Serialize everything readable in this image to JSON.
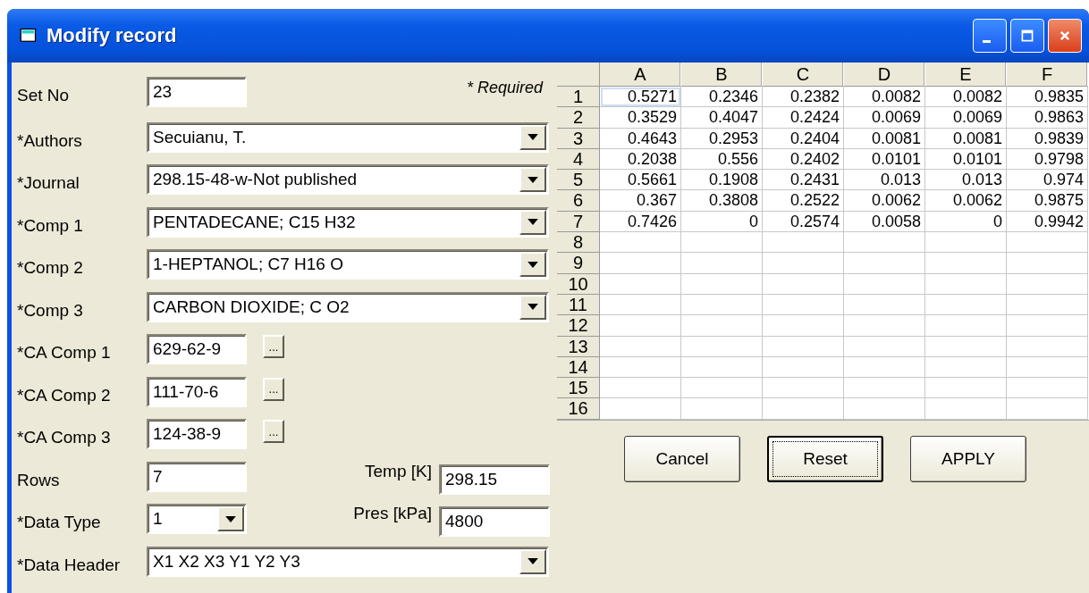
{
  "window": {
    "title": "Modify record"
  },
  "required_note": "* Required",
  "fields": [
    {
      "label": "Set No",
      "kind": "text",
      "value": "23"
    },
    {
      "label": "*Authors",
      "kind": "combo",
      "value": "Secuianu, T."
    },
    {
      "label": "*Journal",
      "kind": "combo",
      "value": "298.15-48-w-Not published"
    },
    {
      "label": "*Comp 1",
      "kind": "combo",
      "value": "PENTADECANE; C15 H32"
    },
    {
      "label": "*Comp 2",
      "kind": "combo",
      "value": "1-HEPTANOL; C7 H16 O"
    },
    {
      "label": "*Comp 3",
      "kind": "combo",
      "value": "CARBON DIOXIDE; C O2"
    },
    {
      "label": "*CA Comp 1",
      "kind": "lookup",
      "value": "629-62-9",
      "button": "..."
    },
    {
      "label": "*CA Comp 2",
      "kind": "lookup",
      "value": "111-70-6",
      "button": "..."
    },
    {
      "label": "*CA Comp 3",
      "kind": "lookup",
      "value": "124-38-9",
      "button": "..."
    },
    {
      "label": "Rows",
      "kind": "text",
      "value": "7",
      "extra": {
        "label": "Temp [K]",
        "value": "298.15"
      }
    },
    {
      "label": "*Data Type",
      "kind": "small_combo",
      "value": "1",
      "extra": {
        "label": "Pres [kPa]",
        "value": "4800"
      }
    },
    {
      "label": "*Data Header",
      "kind": "combo",
      "value": "X1 X2 X3 Y1 Y2 Y3"
    }
  ],
  "table": {
    "columns": [
      "A",
      "B",
      "C",
      "D",
      "E",
      "F"
    ],
    "rows": [
      {
        "label": "1",
        "cells": [
          {
            "text": "0.5271",
            "selected": true
          },
          {
            "text": "0.2346",
            "selected": false
          },
          {
            "text": "0.2382",
            "selected": false
          },
          {
            "text": "0.0082",
            "selected": false
          },
          {
            "text": "0.0082",
            "selected": false
          },
          {
            "text": "0.9835",
            "selected": false
          }
        ]
      },
      {
        "label": "2",
        "cells": [
          {
            "text": "0.3529",
            "selected": false
          },
          {
            "text": "0.4047",
            "selected": false
          },
          {
            "text": "0.2424",
            "selected": false
          },
          {
            "text": "0.0069",
            "selected": false
          },
          {
            "text": "0.0069",
            "selected": false
          },
          {
            "text": "0.9863",
            "selected": false
          }
        ]
      },
      {
        "label": "3",
        "cells": [
          {
            "text": "0.4643",
            "selected": false
          },
          {
            "text": "0.2953",
            "selected": false
          },
          {
            "text": "0.2404",
            "selected": false
          },
          {
            "text": "0.0081",
            "selected": false
          },
          {
            "text": "0.0081",
            "selected": false
          },
          {
            "text": "0.9839",
            "selected": false
          }
        ]
      },
      {
        "label": "4",
        "cells": [
          {
            "text": "0.2038",
            "selected": false
          },
          {
            "text": "0.556",
            "selected": false
          },
          {
            "text": "0.2402",
            "selected": false
          },
          {
            "text": "0.0101",
            "selected": false
          },
          {
            "text": "0.0101",
            "selected": false
          },
          {
            "text": "0.9798",
            "selected": false
          }
        ]
      },
      {
        "label": "5",
        "cells": [
          {
            "text": "0.5661",
            "selected": false
          },
          {
            "text": "0.1908",
            "selected": false
          },
          {
            "text": "0.2431",
            "selected": false
          },
          {
            "text": "0.013",
            "selected": false
          },
          {
            "text": "0.013",
            "selected": false
          },
          {
            "text": "0.974",
            "selected": false
          }
        ]
      },
      {
        "label": "6",
        "cells": [
          {
            "text": "0.367",
            "selected": false
          },
          {
            "text": "0.3808",
            "selected": false
          },
          {
            "text": "0.2522",
            "selected": false
          },
          {
            "text": "0.0062",
            "selected": false
          },
          {
            "text": "0.0062",
            "selected": false
          },
          {
            "text": "0.9875",
            "selected": false
          }
        ]
      },
      {
        "label": "7",
        "cells": [
          {
            "text": "0.7426",
            "selected": false
          },
          {
            "text": "0",
            "selected": false
          },
          {
            "text": "0.2574",
            "selected": false
          },
          {
            "text": "0.0058",
            "selected": false
          },
          {
            "text": "0",
            "selected": false
          },
          {
            "text": "0.9942",
            "selected": false
          }
        ]
      },
      {
        "label": "8"
      },
      {
        "label": "9"
      },
      {
        "label": "10"
      },
      {
        "label": "11"
      },
      {
        "label": "12"
      },
      {
        "label": "13"
      },
      {
        "label": "14"
      },
      {
        "label": "15"
      },
      {
        "label": "16"
      }
    ]
  },
  "buttons": [
    {
      "label": "Cancel",
      "focused": false
    },
    {
      "label": "Reset",
      "focused": true
    },
    {
      "label": "APPLY",
      "focused": false
    }
  ]
}
